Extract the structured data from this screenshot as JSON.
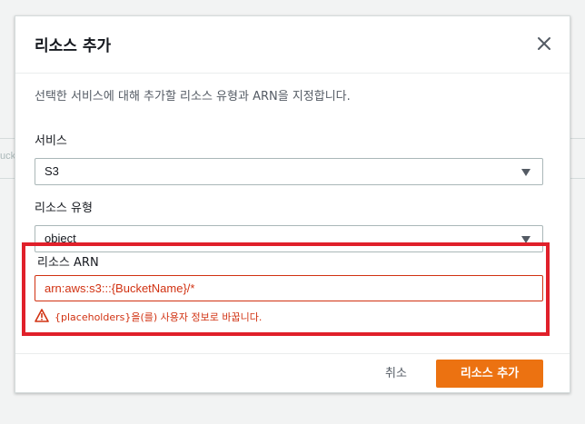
{
  "background": {
    "partial_text": "uck"
  },
  "modal": {
    "title": "리소스 추가",
    "close_icon": "close-icon",
    "description": "선택한 서비스에 대해 추가할 리소스 유형과 ARN을 지정합니다.",
    "service": {
      "label": "서비스",
      "value": "S3"
    },
    "resource_type": {
      "label": "리소스 유형",
      "value": "object"
    },
    "resource_arn": {
      "label": "리소스 ARN",
      "value": "arn:aws:s3:::{BucketName}/*",
      "warning": "{placeholders}을(를) 사용자 정보로 바꿉니다.",
      "warning_icon": "warning-icon"
    },
    "footer": {
      "cancel_label": "취소",
      "add_label": "리소스 추가"
    }
  },
  "colors": {
    "accent": "#ec7211",
    "error": "#d13212",
    "highlight": "#e0202a"
  }
}
